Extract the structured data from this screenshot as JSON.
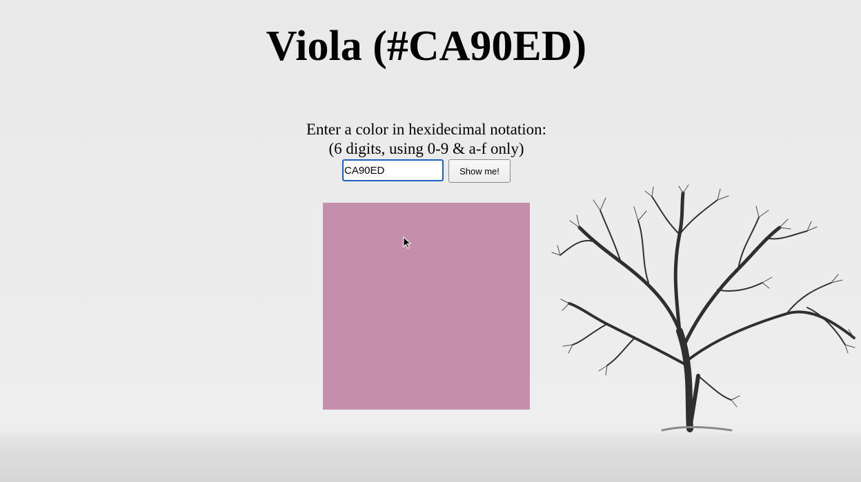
{
  "page": {
    "title": "Viola (#CA90ED)"
  },
  "prompt": {
    "line1": "Enter a color in hexidecimal notation:",
    "line2": "(6 digits, using 0-9 & a-f only)"
  },
  "form": {
    "hex_value": "CA90ED",
    "submit_label": "Show me!"
  },
  "swatch": {
    "color": "#C48FAD"
  },
  "colors": {
    "input_focus_border": "#1F5FBF",
    "background": "#ECECEC"
  },
  "icons": {
    "cursor": "mouse-pointer-icon",
    "tree": "tree-illustration"
  }
}
